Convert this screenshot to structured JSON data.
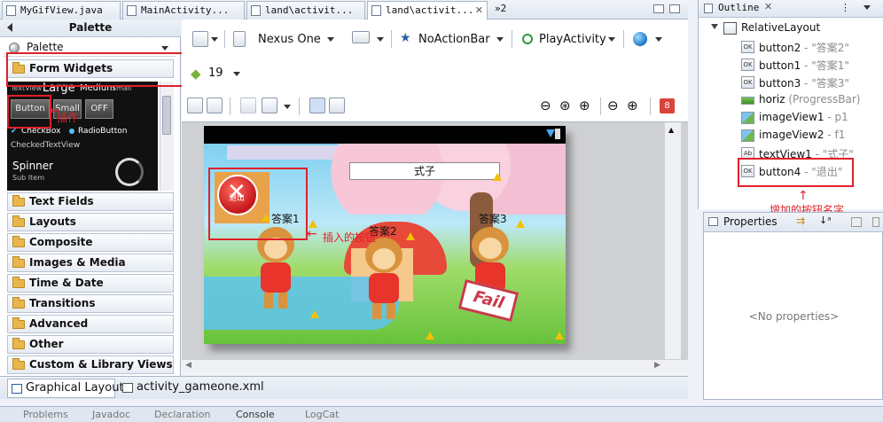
{
  "editor_tabs": [
    {
      "label": "MyGifView.java",
      "active": false
    },
    {
      "label": "MainActivity...",
      "active": false
    },
    {
      "label": "land\\activit...",
      "active": false
    },
    {
      "label": "land\\activit...",
      "active": true
    }
  ],
  "tab_overflow": "»2",
  "palette": {
    "title": "Palette",
    "selector_label": "Palette",
    "categories": [
      "Form Widgets",
      "Text Fields",
      "Layouts",
      "Composite",
      "Images & Media",
      "Time & Date",
      "Transitions",
      "Advanced",
      "Other",
      "Custom & Library Views"
    ],
    "form_widgets": {
      "textview_row": [
        "TextView",
        "Large",
        "Medium",
        "Small"
      ],
      "buttons": [
        "Button",
        "Small",
        "OFF"
      ],
      "checkbox": "CheckBox",
      "radio": "RadioButton",
      "checked_text": "CheckedTextView",
      "spinner": "Spinner",
      "spinner_sub": "Sub Item"
    }
  },
  "toolbar": {
    "device": "Nexus One",
    "theme": "NoActionBar",
    "activity": "PlayActivity",
    "api_level": "19",
    "error_count": "8"
  },
  "game": {
    "formula_label": "式子",
    "answers": [
      "答案1",
      "答案2",
      "答案3"
    ],
    "fail_text": "Fail",
    "exit_button_text": "退出"
  },
  "annotations": {
    "plugin": "插件",
    "inserted_button": "插入的按钮",
    "added_button_name": "增加的按钮名字"
  },
  "bottom_tabs": [
    "Graphical Layout",
    "activity_gameone.xml"
  ],
  "outline": {
    "title": "Outline",
    "root": "RelativeLayout",
    "nodes": [
      {
        "name": "button2",
        "value": "- \"答案2\"",
        "icon": "button"
      },
      {
        "name": "button1",
        "value": "- \"答案1\"",
        "icon": "button"
      },
      {
        "name": "button3",
        "value": "- \"答案3\"",
        "icon": "button"
      },
      {
        "name": "horiz",
        "value": "(ProgressBar)",
        "icon": "bar"
      },
      {
        "name": "imageView1",
        "value": "- p1",
        "icon": "image"
      },
      {
        "name": "imageView2",
        "value": "- f1",
        "icon": "image"
      },
      {
        "name": "textView1",
        "value": "- \"式子\"",
        "icon": "text"
      },
      {
        "name": "button4",
        "value": "- \"退出\"",
        "icon": "button"
      }
    ]
  },
  "properties": {
    "title": "Properties",
    "empty": "<No properties>"
  },
  "statusbar": [
    "Problems",
    "Javadoc",
    "Declaration",
    "Console",
    "LogCat"
  ],
  "colors": {
    "annotation_red": "#e0202a",
    "accent_blue": "#2a5da8"
  }
}
